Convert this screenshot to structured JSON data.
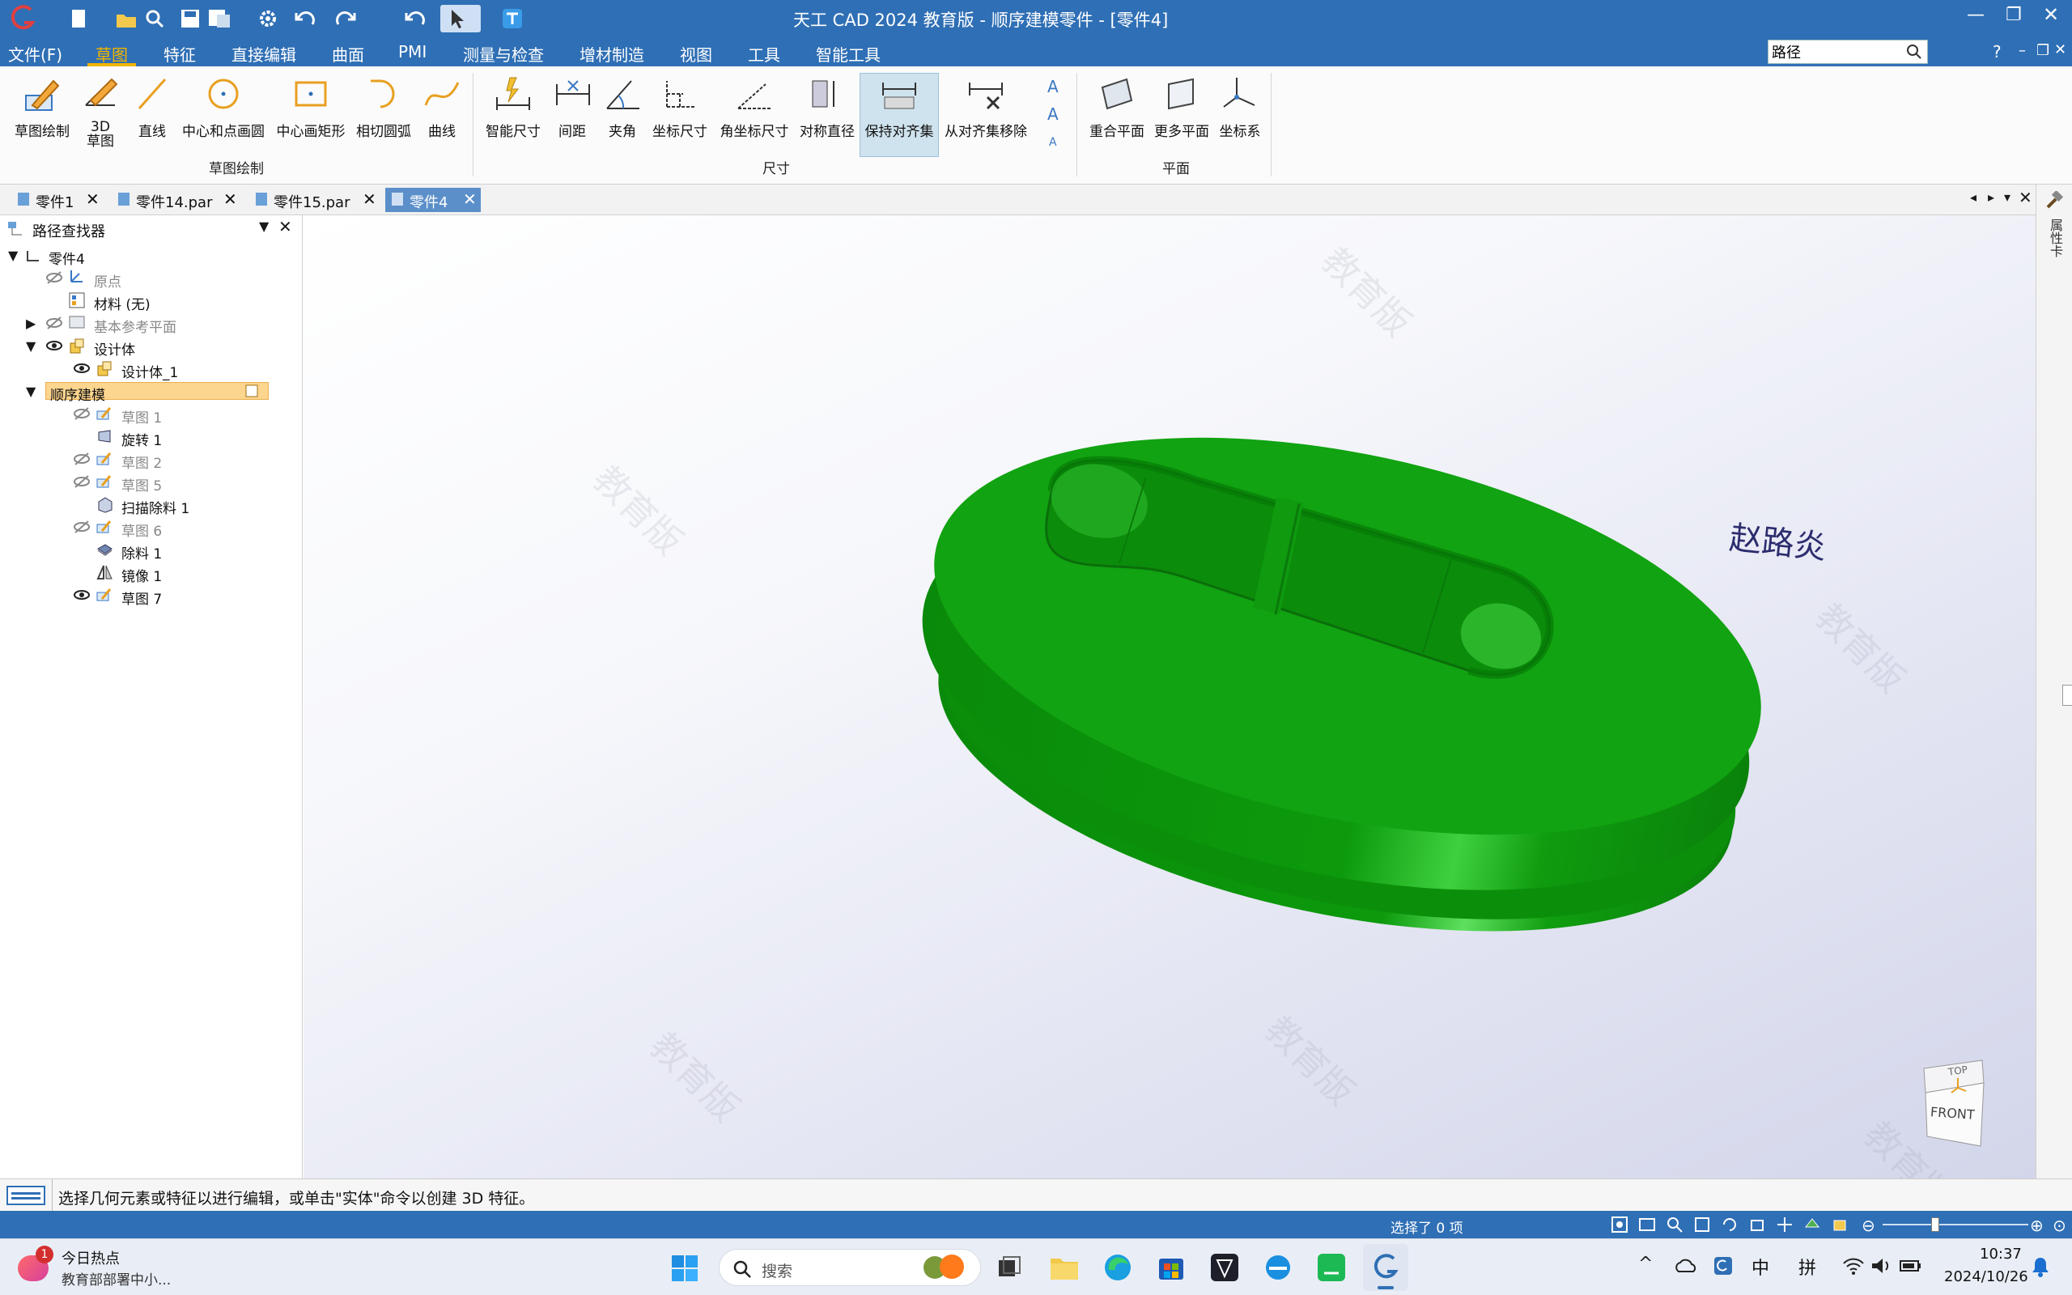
{
  "window": {
    "title": "天工 CAD 2024 教育版 - 顺序建模零件 - [零件4]",
    "search_value": "路径",
    "help": "?"
  },
  "menu": {
    "file": "文件(F)",
    "tabs": [
      "草图",
      "特征",
      "直接编辑",
      "曲面",
      "PMI",
      "测量与检查",
      "增材制造",
      "视图",
      "工具",
      "智能工具"
    ]
  },
  "ribbon": {
    "sketch_group": {
      "label": "草图绘制",
      "buttons": [
        "草图绘制",
        "3D",
        "草图",
        "直线",
        "中心和点画圆",
        "中心画矩形",
        "相切圆弧",
        "曲线"
      ]
    },
    "dimension_group": {
      "label": "尺寸",
      "buttons": [
        "智能尺寸",
        "间距",
        "夹角",
        "坐标尺寸",
        "角坐标尺寸",
        "对称直径",
        "保持对齐集",
        "从对齐集移除"
      ]
    },
    "plane_group": {
      "label": "平面",
      "buttons": [
        "重合平面",
        "更多平面",
        "坐标系"
      ]
    }
  },
  "doc_tabs": [
    "零件1",
    "零件14.par",
    "零件15.par",
    "零件4"
  ],
  "pathfinder": {
    "title": "路径查找器",
    "items": [
      {
        "label": "零件4"
      },
      {
        "label": "原点"
      },
      {
        "label": "材料 (无)"
      },
      {
        "label": "基本参考平面"
      },
      {
        "label": "设计体"
      },
      {
        "label": "设计体_1"
      },
      {
        "label": "顺序建模"
      },
      {
        "label": "草图 1"
      },
      {
        "label": "旋转 1"
      },
      {
        "label": "草图 2"
      },
      {
        "label": "草图 5"
      },
      {
        "label": "扫描除料 1"
      },
      {
        "label": "草图 6"
      },
      {
        "label": "除料 1"
      },
      {
        "label": "镜像 1"
      },
      {
        "label": "草图 7"
      }
    ]
  },
  "viewport": {
    "annotation": "赵路炎",
    "watermark": "教育版",
    "view_cube_top": "TOP",
    "view_cube_front": "FRONT",
    "model_color": "#0fa30f"
  },
  "right_strip": {
    "label": "属性卡"
  },
  "prompt": "选择几何元素或特征以进行编辑，或单击\"实体\"命令以创建 3D 特征。",
  "status": {
    "selection": "选择了 0 项"
  },
  "taskbar": {
    "news_title": "今日热点",
    "news_sub": "教育部部署中小...",
    "badge": "1",
    "search_placeholder": "搜索",
    "ime_lang": "中",
    "ime_mode": "拼",
    "time": "10:37",
    "date": "2024/10/26"
  },
  "colors": {
    "title_blue": "#2f6fb5",
    "accent": "#f0b400",
    "ribbon_active": "#cfe3ee"
  }
}
